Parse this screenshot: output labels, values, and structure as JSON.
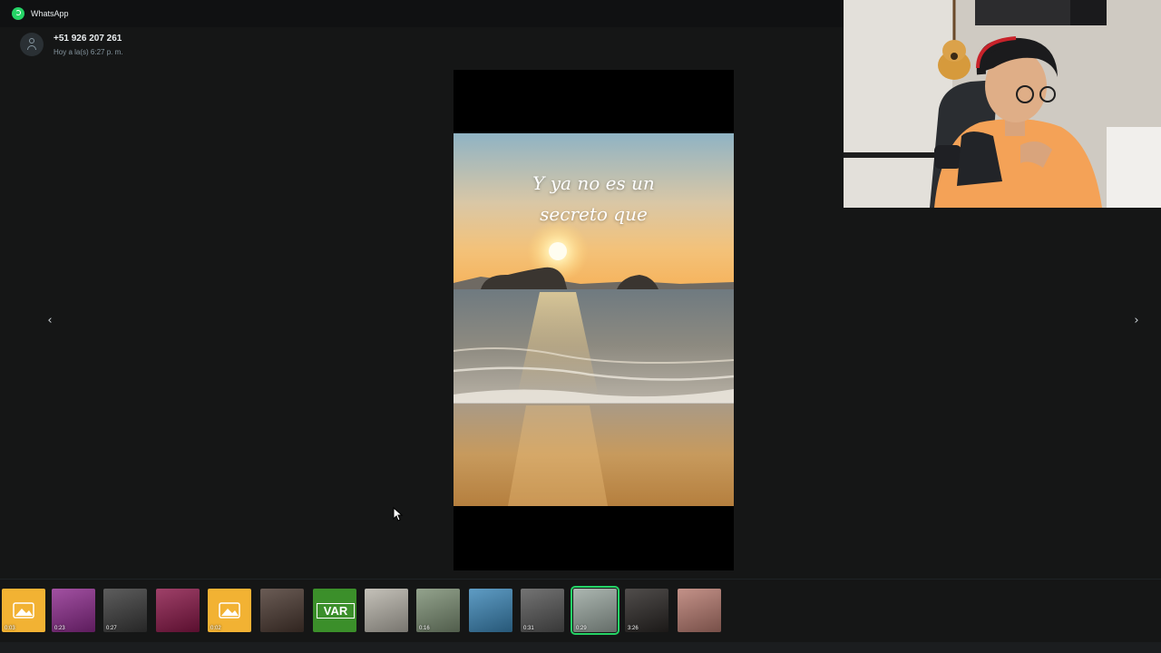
{
  "window": {
    "app_title": "WhatsApp"
  },
  "contact": {
    "number": "+51 926 207 261",
    "time": "Hoy a la(s) 6:27 p. m."
  },
  "viewer": {
    "caption_line1": "Y ya no es un",
    "caption_line2": "secreto que",
    "prev_glyph": "‹",
    "next_glyph": "›"
  },
  "thumbnails": [
    {
      "kind": "image-icon",
      "duration": "0:03",
      "color": "#f2b233"
    },
    {
      "kind": "video",
      "duration": "0:23",
      "color": "#8e2b8e"
    },
    {
      "kind": "video",
      "duration": "0:27",
      "color": "#3a3a3a"
    },
    {
      "kind": "video",
      "duration": "",
      "color": "#8a1748"
    },
    {
      "kind": "image-icon",
      "duration": "0:02",
      "color": "#f2b233"
    },
    {
      "kind": "video",
      "duration": "",
      "color": "#4a3830"
    },
    {
      "kind": "image",
      "duration": "",
      "label": "VAR",
      "color": "#3b8f2a"
    },
    {
      "kind": "video",
      "duration": "",
      "color": "#b8b4aa"
    },
    {
      "kind": "video",
      "duration": "0:16",
      "color": "#7c8f74"
    },
    {
      "kind": "video",
      "duration": "",
      "color": "#3c87b8"
    },
    {
      "kind": "video",
      "duration": "0:31",
      "color": "#555555"
    },
    {
      "kind": "video",
      "duration": "0:29",
      "color": "#9aa7a0",
      "active": true
    },
    {
      "kind": "video",
      "duration": "3:26",
      "color": "#2a2624"
    },
    {
      "kind": "image",
      "duration": "",
      "color": "#b77a6f"
    }
  ],
  "colors": {
    "accent": "#25d366",
    "background": "#151616",
    "titlebar": "#101112"
  }
}
